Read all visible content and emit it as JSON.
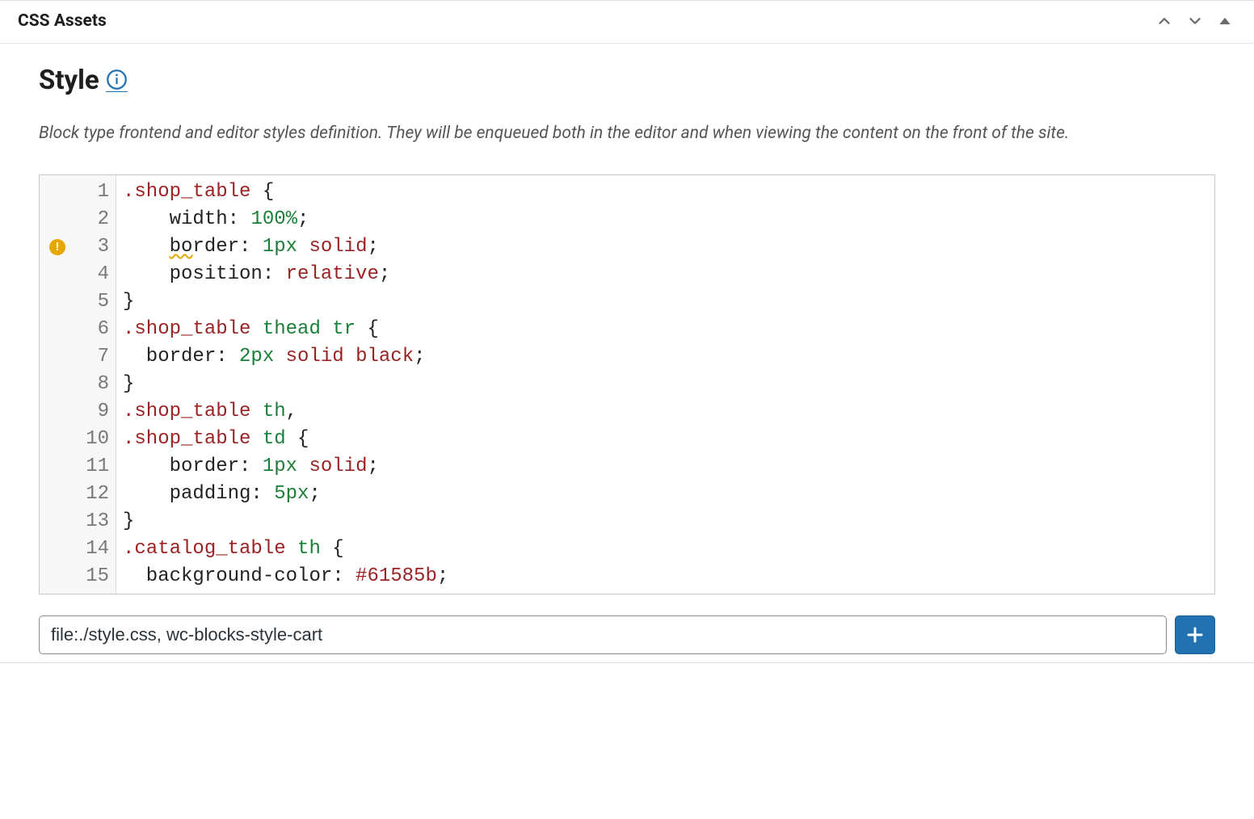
{
  "panel": {
    "title": "CSS Assets"
  },
  "section": {
    "title": "Style",
    "description": "Block type frontend and editor styles definition. They will be enqueued both in the editor and when viewing the content on the front of the site."
  },
  "code": {
    "warningLine": 3,
    "lines": [
      {
        "n": 1,
        "tokens": [
          {
            "t": ".shop_table",
            "c": "tok-class"
          },
          {
            "t": " {"
          }
        ]
      },
      {
        "n": 2,
        "tokens": [
          {
            "t": "    width: "
          },
          {
            "t": "100%",
            "c": "tok-num"
          },
          {
            "t": ";"
          }
        ]
      },
      {
        "n": 3,
        "tokens": [
          {
            "t": "    "
          },
          {
            "t": "bo",
            "c": "squiggle"
          },
          {
            "t": "rder: "
          },
          {
            "t": "1px",
            "c": "tok-num"
          },
          {
            "t": " "
          },
          {
            "t": "solid",
            "c": "tok-kw"
          },
          {
            "t": ";"
          }
        ]
      },
      {
        "n": 4,
        "tokens": [
          {
            "t": "    position: "
          },
          {
            "t": "relative",
            "c": "tok-kw"
          },
          {
            "t": ";"
          }
        ]
      },
      {
        "n": 5,
        "tokens": [
          {
            "t": "}"
          }
        ]
      },
      {
        "n": 6,
        "tokens": [
          {
            "t": ".shop_table",
            "c": "tok-class"
          },
          {
            "t": " "
          },
          {
            "t": "thead",
            "c": "tok-tag"
          },
          {
            "t": " "
          },
          {
            "t": "tr",
            "c": "tok-tag"
          },
          {
            "t": " {"
          }
        ]
      },
      {
        "n": 7,
        "tokens": [
          {
            "t": "  border: "
          },
          {
            "t": "2px",
            "c": "tok-num"
          },
          {
            "t": " "
          },
          {
            "t": "solid",
            "c": "tok-kw"
          },
          {
            "t": " "
          },
          {
            "t": "black",
            "c": "tok-kw"
          },
          {
            "t": ";"
          }
        ]
      },
      {
        "n": 8,
        "tokens": [
          {
            "t": "}"
          }
        ]
      },
      {
        "n": 9,
        "tokens": [
          {
            "t": ".shop_table",
            "c": "tok-class"
          },
          {
            "t": " "
          },
          {
            "t": "th",
            "c": "tok-tag"
          },
          {
            "t": ","
          }
        ]
      },
      {
        "n": 10,
        "tokens": [
          {
            "t": ".shop_table",
            "c": "tok-class"
          },
          {
            "t": " "
          },
          {
            "t": "td",
            "c": "tok-tag"
          },
          {
            "t": " {"
          }
        ]
      },
      {
        "n": 11,
        "tokens": [
          {
            "t": "    border: "
          },
          {
            "t": "1px",
            "c": "tok-num"
          },
          {
            "t": " "
          },
          {
            "t": "solid",
            "c": "tok-kw"
          },
          {
            "t": ";"
          }
        ]
      },
      {
        "n": 12,
        "tokens": [
          {
            "t": "    padding: "
          },
          {
            "t": "5px",
            "c": "tok-num"
          },
          {
            "t": ";"
          }
        ]
      },
      {
        "n": 13,
        "tokens": [
          {
            "t": "}"
          }
        ]
      },
      {
        "n": 14,
        "tokens": [
          {
            "t": ".catalog_table",
            "c": "tok-class"
          },
          {
            "t": " "
          },
          {
            "t": "th",
            "c": "tok-tag"
          },
          {
            "t": " {"
          }
        ]
      },
      {
        "n": 15,
        "tokens": [
          {
            "t": "  background-color: "
          },
          {
            "t": "#61585b",
            "c": "tok-color"
          },
          {
            "t": ";"
          }
        ]
      }
    ]
  },
  "assetInput": {
    "value": "file:./style.css, wc-blocks-style-cart"
  }
}
